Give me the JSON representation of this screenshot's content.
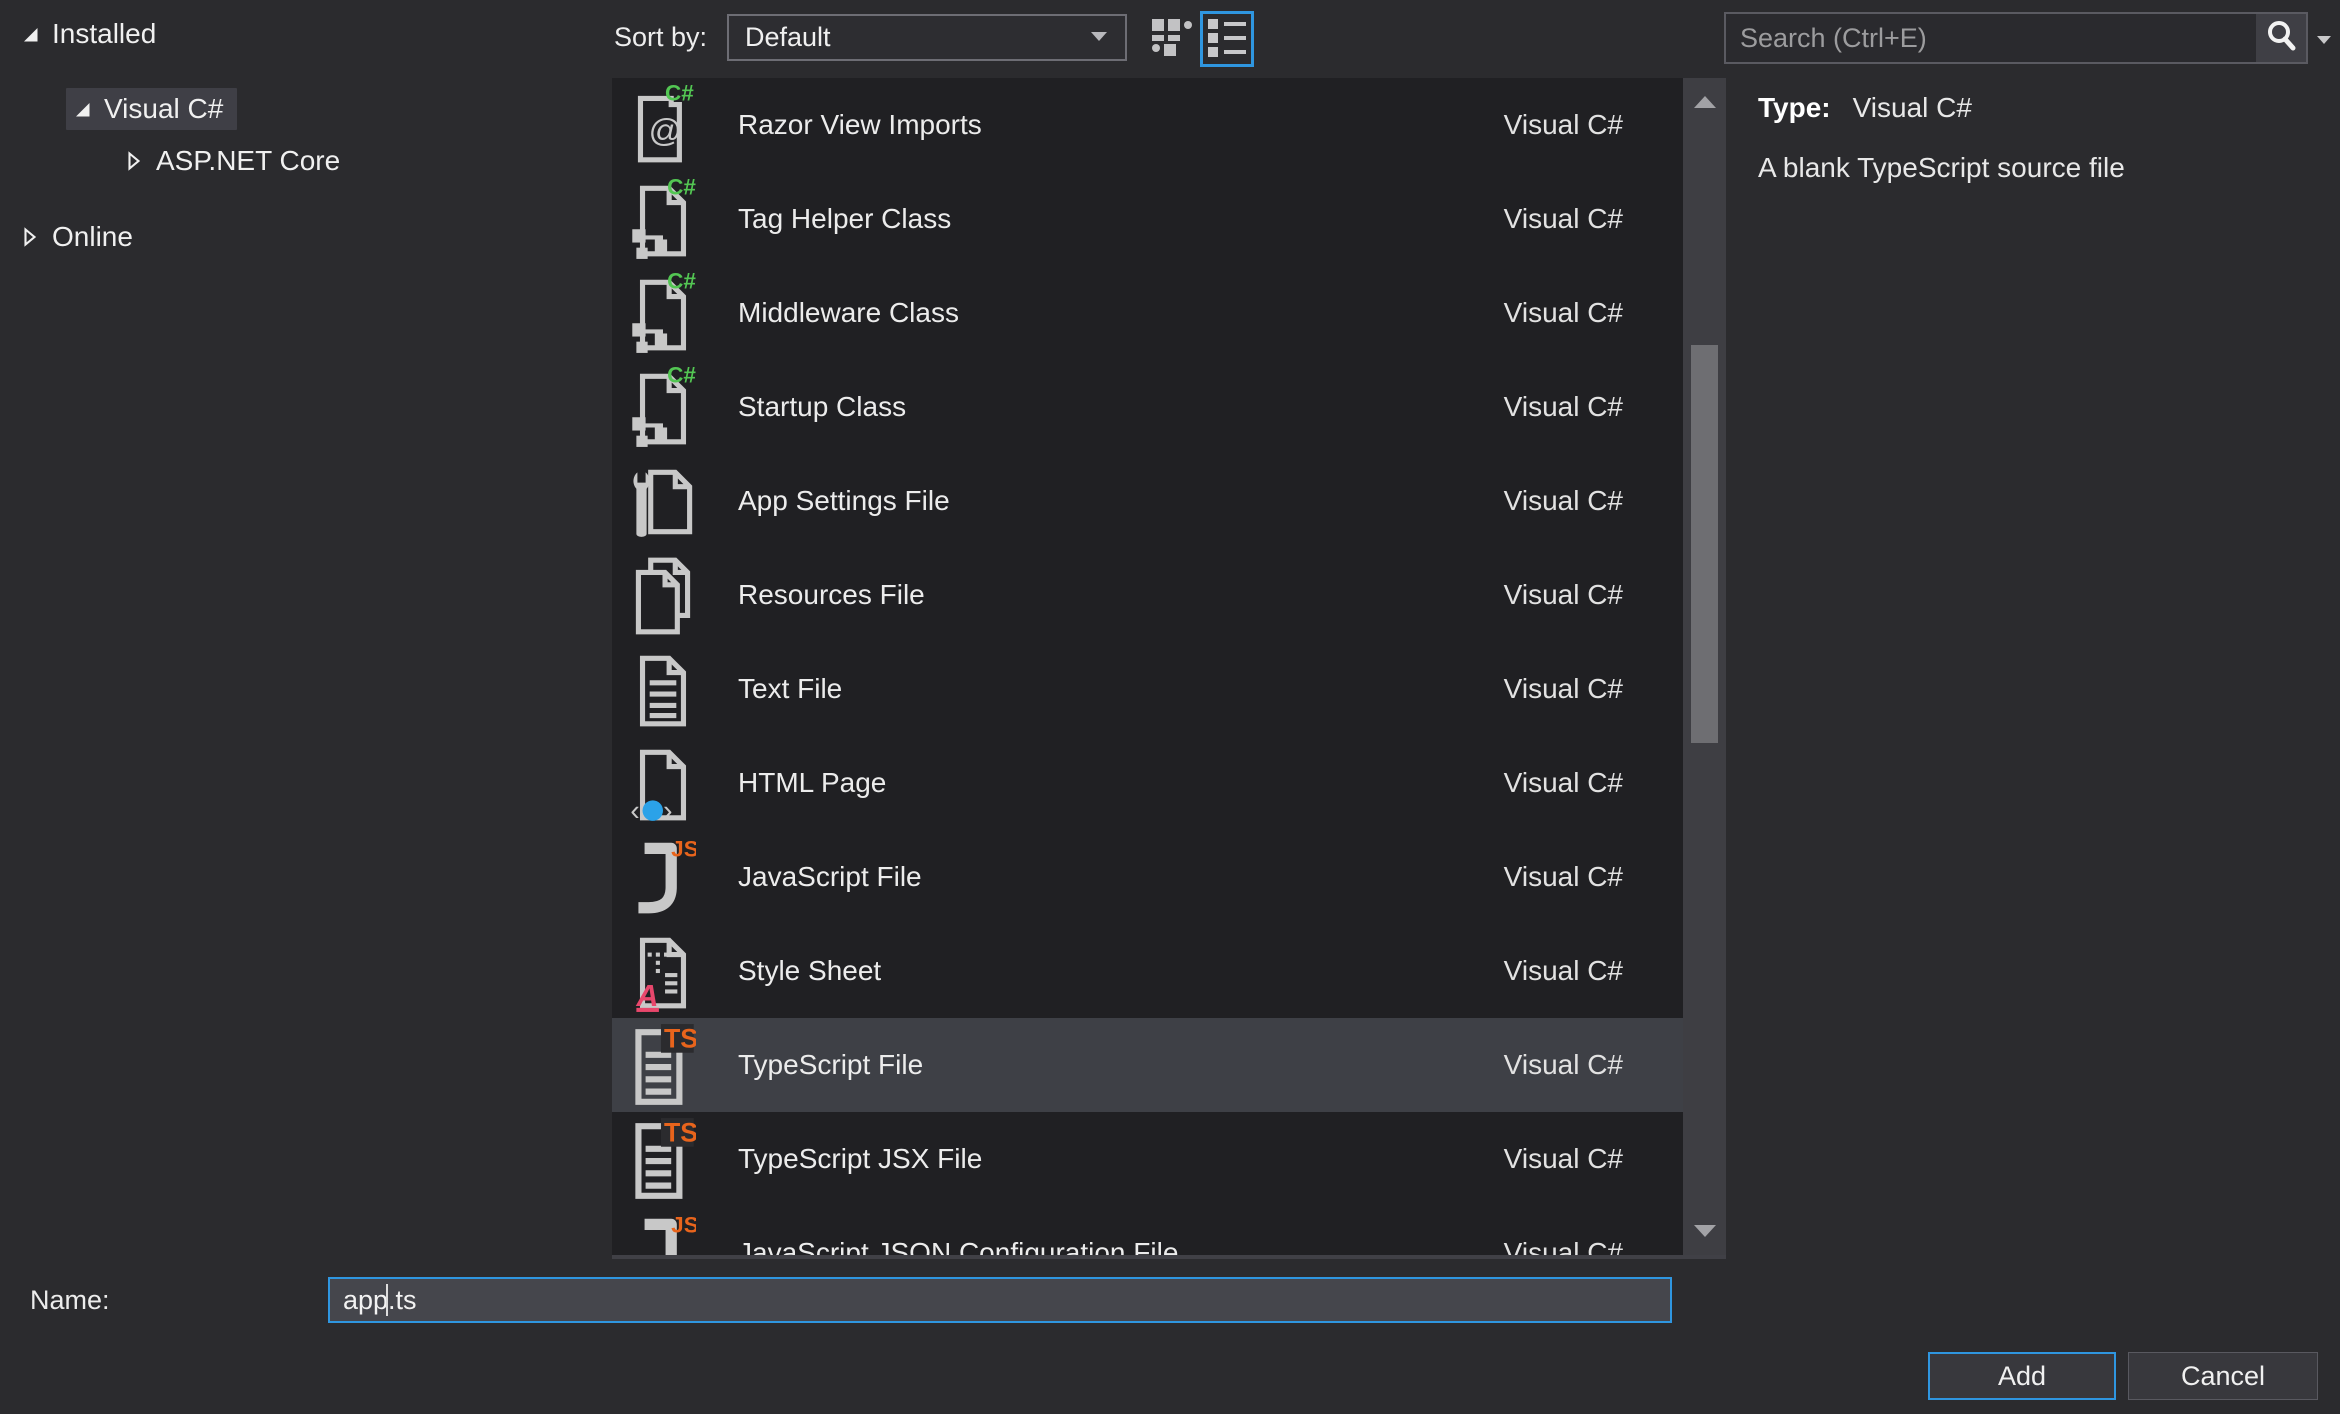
{
  "tree": {
    "items": [
      {
        "label": "Installed",
        "state": "expanded",
        "level": 0,
        "selected": false
      },
      {
        "label": "Visual C#",
        "state": "expanded",
        "level": 1,
        "selected": true
      },
      {
        "label": "ASP.NET Core",
        "state": "collapsed",
        "level": 2,
        "selected": false
      },
      {
        "label": "Online",
        "state": "collapsed",
        "level": 0,
        "selected": false
      }
    ]
  },
  "toolbar": {
    "sort_label": "Sort by:",
    "sort_value": "Default",
    "view_modes": [
      "grid-view-icon",
      "list-view-icon"
    ],
    "active_view": "list"
  },
  "search": {
    "placeholder": "Search (Ctrl+E)"
  },
  "details": {
    "type_label": "Type:",
    "type_value": "Visual C#",
    "description": "A blank TypeScript source file"
  },
  "templates": {
    "items": [
      {
        "icon": "razor",
        "label": "Razor View Imports",
        "category": "Visual C#",
        "selected": false
      },
      {
        "icon": "cs-class",
        "label": "Tag Helper Class",
        "category": "Visual C#",
        "selected": false
      },
      {
        "icon": "cs-class",
        "label": "Middleware Class",
        "category": "Visual C#",
        "selected": false
      },
      {
        "icon": "cs-class",
        "label": "Startup Class",
        "category": "Visual C#",
        "selected": false
      },
      {
        "icon": "appsettings",
        "label": "App Settings File",
        "category": "Visual C#",
        "selected": false
      },
      {
        "icon": "resources",
        "label": "Resources File",
        "category": "Visual C#",
        "selected": false
      },
      {
        "icon": "textfile",
        "label": "Text File",
        "category": "Visual C#",
        "selected": false
      },
      {
        "icon": "html",
        "label": "HTML Page",
        "category": "Visual C#",
        "selected": false
      },
      {
        "icon": "js",
        "label": "JavaScript File",
        "category": "Visual C#",
        "selected": false
      },
      {
        "icon": "css",
        "label": "Style Sheet",
        "category": "Visual C#",
        "selected": false
      },
      {
        "icon": "ts",
        "label": "TypeScript File",
        "category": "Visual C#",
        "selected": true
      },
      {
        "icon": "ts",
        "label": "TypeScript JSX File",
        "category": "Visual C#",
        "selected": false
      },
      {
        "icon": "json",
        "label": "JavaScript JSON Configuration File",
        "category": "Visual C#",
        "selected": false
      }
    ]
  },
  "footer": {
    "name_label": "Name:",
    "name_value": "app.ts",
    "add_label": "Add",
    "cancel_label": "Cancel"
  },
  "colors": {
    "accent_blue": "#2f96e0",
    "csharp_green": "#53c653",
    "script_orange": "#e8641c",
    "style_pink": "#e8476c",
    "html_blue": "#2ba2e8",
    "selection_gray": "#3e4046"
  }
}
